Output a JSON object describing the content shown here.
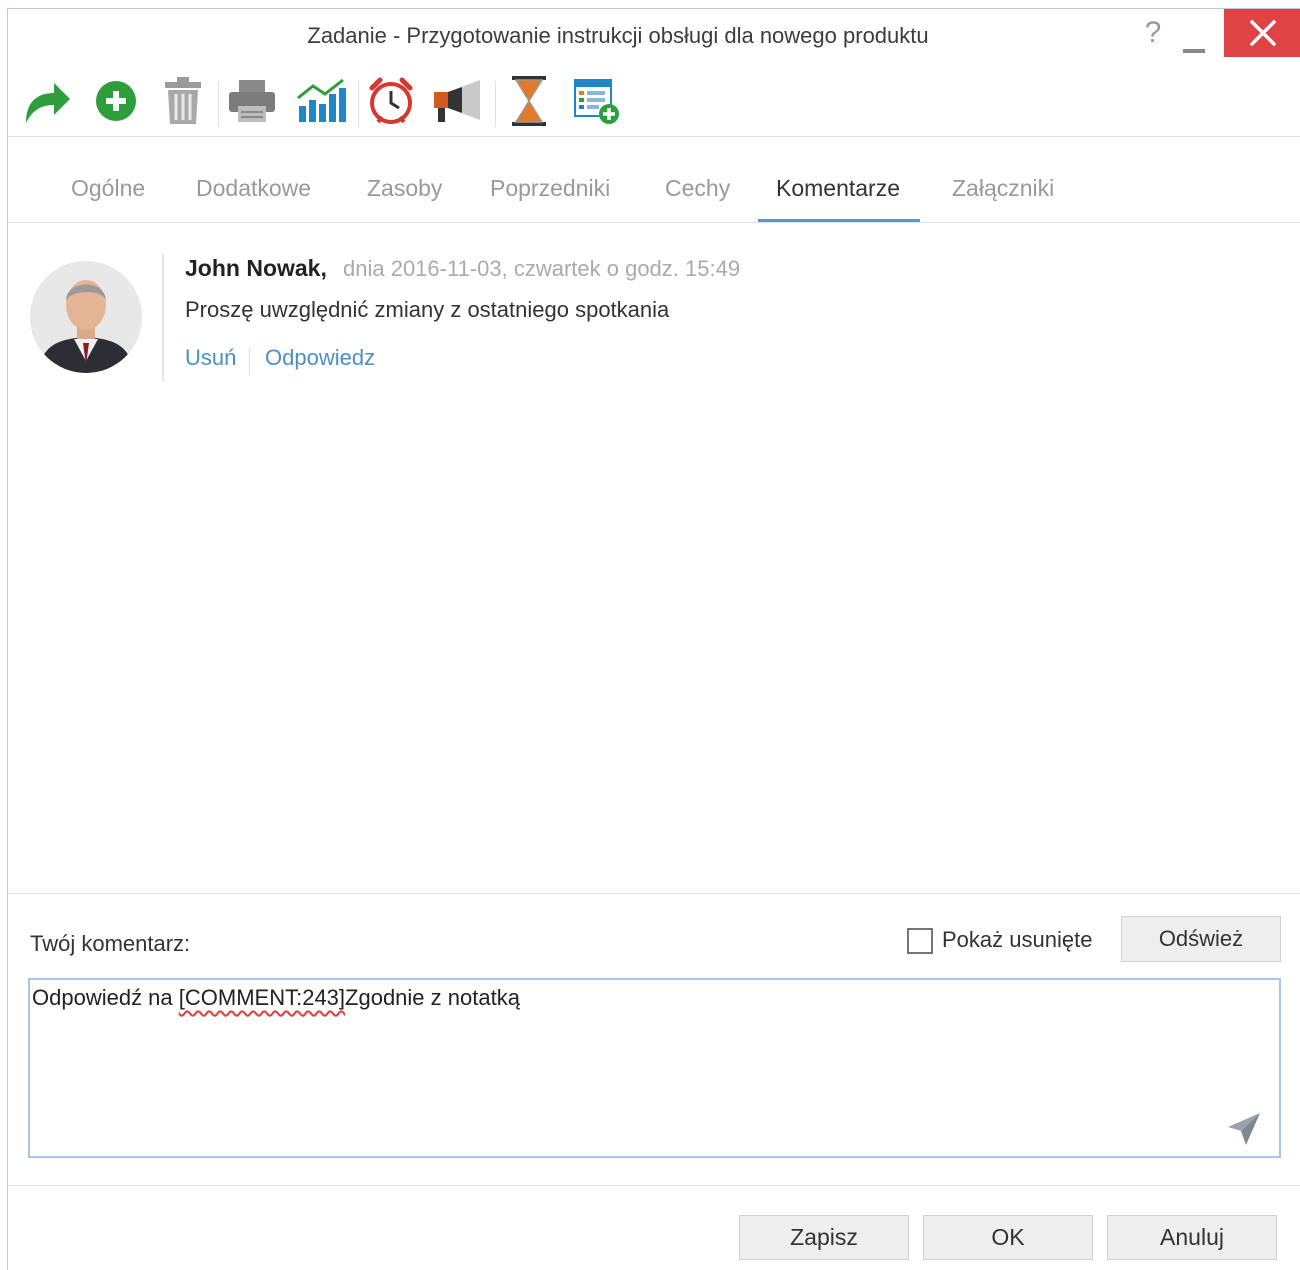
{
  "window": {
    "title": "Zadanie - Przygotowanie instrukcji obsługi dla nowego produktu",
    "help_label": "?"
  },
  "toolbar": {
    "icons": [
      "forward-arrow-icon",
      "add-circle-icon",
      "trash-icon",
      "printer-icon",
      "chart-icon",
      "alarm-clock-icon",
      "megaphone-icon",
      "hourglass-icon",
      "add-window-icon"
    ]
  },
  "tabs": [
    {
      "label": "Ogólne"
    },
    {
      "label": "Dodatkowe"
    },
    {
      "label": "Zasoby"
    },
    {
      "label": "Poprzedniki"
    },
    {
      "label": "Cechy"
    },
    {
      "label": "Komentarze",
      "active": true
    },
    {
      "label": "Załączniki"
    }
  ],
  "comment": {
    "author": "John Nowak",
    "date": "dnia 2016-11-03, czwartek o godz. 15:49",
    "text": "Proszę uwzględnić zmiany z ostatniego spotkania",
    "delete_label": "Usuń",
    "reply_label": "Odpowiedz"
  },
  "compose": {
    "label": "Twój komentarz:",
    "show_deleted_label": "Pokaż usunięte",
    "show_deleted_checked": false,
    "refresh_label": "Odśwież",
    "value_prefix": "Odpowiedź na ",
    "value_token": "[COMMENT:243]",
    "value_suffix": "Zgodnie z notatką"
  },
  "footer": {
    "save_label": "Zapisz",
    "ok_label": "OK",
    "cancel_label": "Anuluj"
  },
  "colors": {
    "accent": "#4d9ad6",
    "link": "#4a90c7",
    "close": "#e04343"
  }
}
